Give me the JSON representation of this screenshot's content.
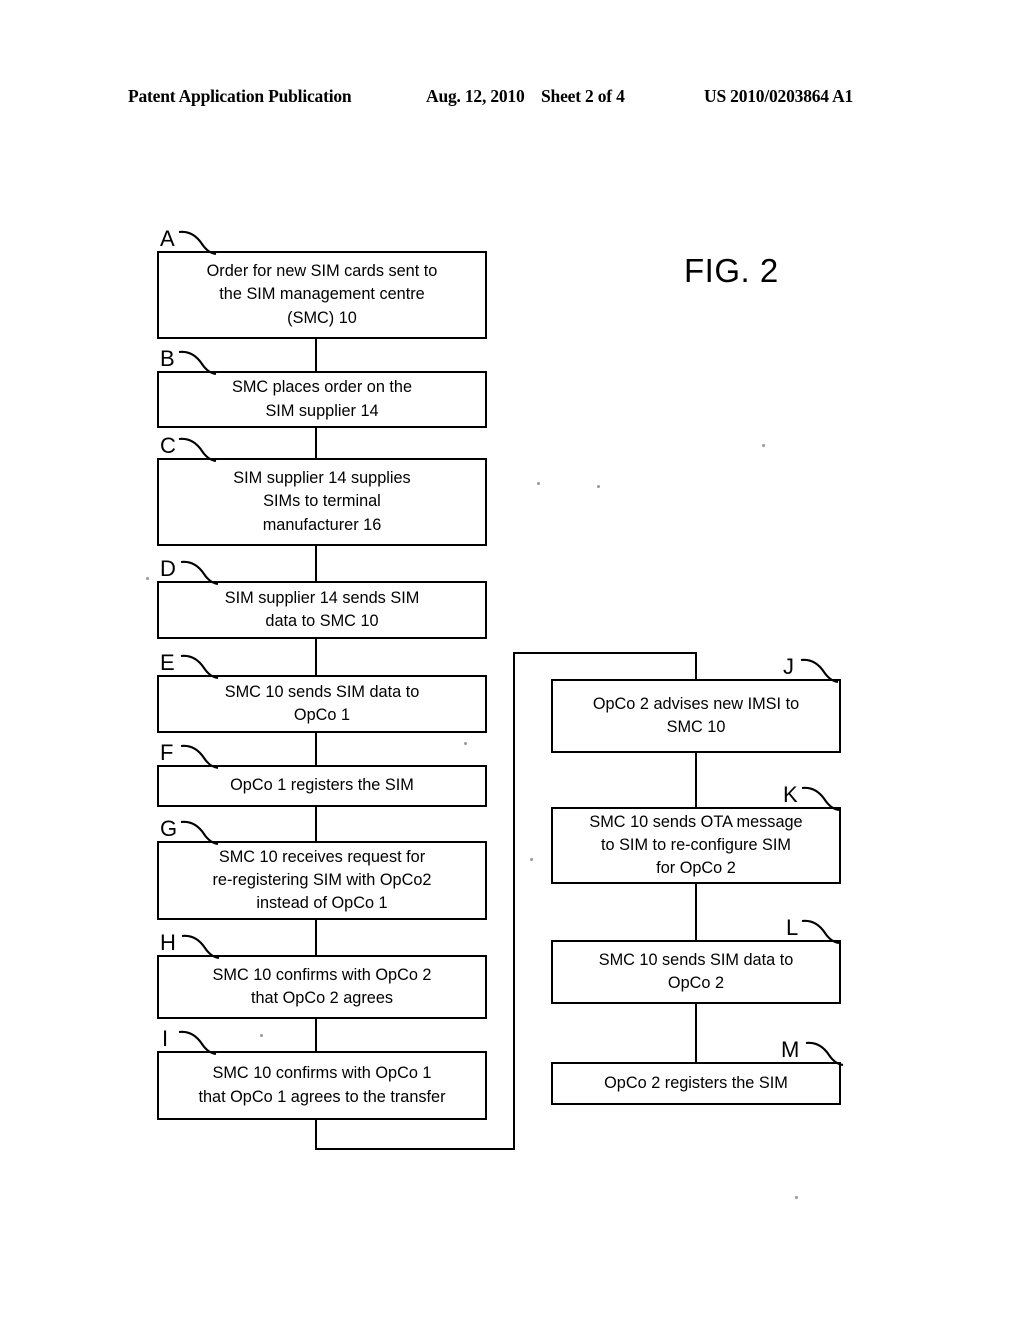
{
  "header": {
    "publication": "Patent Application Publication",
    "date": "Aug. 12, 2010",
    "sheet": "Sheet 2 of 4",
    "patent_number": "US 2010/0203864 A1"
  },
  "figure": {
    "title": "FIG. 2"
  },
  "flowchart": {
    "left_column": [
      {
        "id": "A",
        "label": "A",
        "text": "Order for new SIM cards sent to\nthe SIM management centre\n(SMC) 10"
      },
      {
        "id": "B",
        "label": "B",
        "text": "SMC places order on the\nSIM  supplier 14"
      },
      {
        "id": "C",
        "label": "C",
        "text": "SIM supplier 14 supplies\nSIMs to terminal\nmanufacturer 16"
      },
      {
        "id": "D",
        "label": "D",
        "text": "SIM supplier 14 sends SIM\ndata to SMC 10"
      },
      {
        "id": "E",
        "label": "E",
        "text": "SMC 10 sends SIM data to\nOpCo 1"
      },
      {
        "id": "F",
        "label": "F",
        "text": "OpCo 1 registers the SIM"
      },
      {
        "id": "G",
        "label": "G",
        "text": "SMC 10 receives request for\nre-registering SIM with OpCo2\ninstead of OpCo 1"
      },
      {
        "id": "H",
        "label": "H",
        "text": "SMC 10 confirms with OpCo 2\nthat OpCo 2 agrees"
      },
      {
        "id": "I",
        "label": "I",
        "text": "SMC 10 confirms with OpCo 1\nthat OpCo 1 agrees to the transfer"
      }
    ],
    "right_column": [
      {
        "id": "J",
        "label": "J",
        "text": "OpCo 2 advises new IMSI to\nSMC 10"
      },
      {
        "id": "K",
        "label": "K",
        "text": "SMC 10 sends OTA message\nto SIM to re-configure SIM\nfor OpCo 2"
      },
      {
        "id": "L",
        "label": "L",
        "text": "SMC 10 sends SIM data to\nOpCo 2"
      },
      {
        "id": "M",
        "label": "M",
        "text": "OpCo 2 registers the SIM"
      }
    ]
  },
  "colors": {
    "ink": "#000000",
    "paper": "#ffffff"
  }
}
